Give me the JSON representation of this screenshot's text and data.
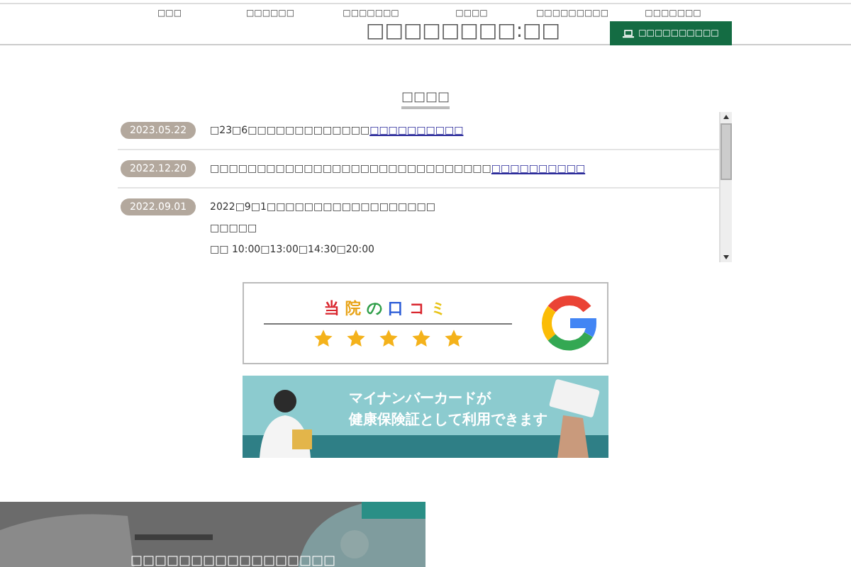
{
  "header": {
    "title": "□□□□□□□□:□□",
    "nav": [
      "□□□",
      "□□□□□□",
      "□□□□□□□",
      "□□□□",
      "□□□□□□□□□",
      "□□□□□□□"
    ],
    "button": "□□□□□□□□□□"
  },
  "news": {
    "heading": "□□□□",
    "items": [
      {
        "date": "2023.05.22",
        "lines": [
          "□23□6□□□□□□□□□□□□□"
        ],
        "link": "□□□□□□□□□□"
      },
      {
        "date": "2022.12.20",
        "lines": [
          "□□□□□□□□□□□□□□□□□□□□□□□□□□□□□□"
        ],
        "link": "□□□□□□□□□□"
      },
      {
        "date": "2022.09.01",
        "lines": [
          "2022□9□1□□□□□□□□□□□□□□□□□□",
          "□□□□□",
          "□□ 10:00□13:00□14:30□20:00"
        ]
      }
    ]
  },
  "review_banner": {
    "heading": "当院の口コミ",
    "stars": 5
  },
  "card_banner": {
    "kind": "picture",
    "lines": [
      "マイナンバーカードが",
      "健康保険証として利用できます"
    ]
  },
  "hero": {
    "kind": "picture",
    "title": "□□□□□□□□□□□□□□□□□"
  }
}
